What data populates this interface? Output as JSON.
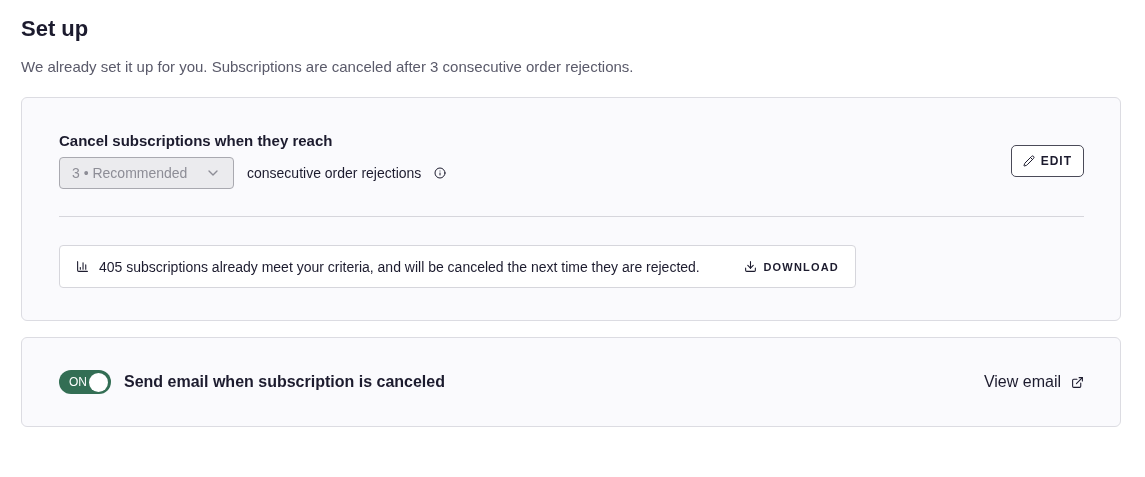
{
  "title": "Set up",
  "subtitle": "We already set it up for you. Subscriptions are canceled after 3 consecutive order rejections.",
  "rule_card": {
    "heading": "Cancel subscriptions when they reach",
    "select": {
      "value": "3 • Recommended",
      "disabled": true
    },
    "suffix": "consecutive order rejections",
    "edit_button": "EDIT",
    "notice": {
      "text": "405 subscriptions already meet your criteria, and will be canceled the next time they are rejected.",
      "action": "DOWNLOAD"
    }
  },
  "email_card": {
    "toggle": {
      "label": "ON",
      "on": true
    },
    "label": "Send email when subscription is canceled",
    "link": "View email"
  }
}
